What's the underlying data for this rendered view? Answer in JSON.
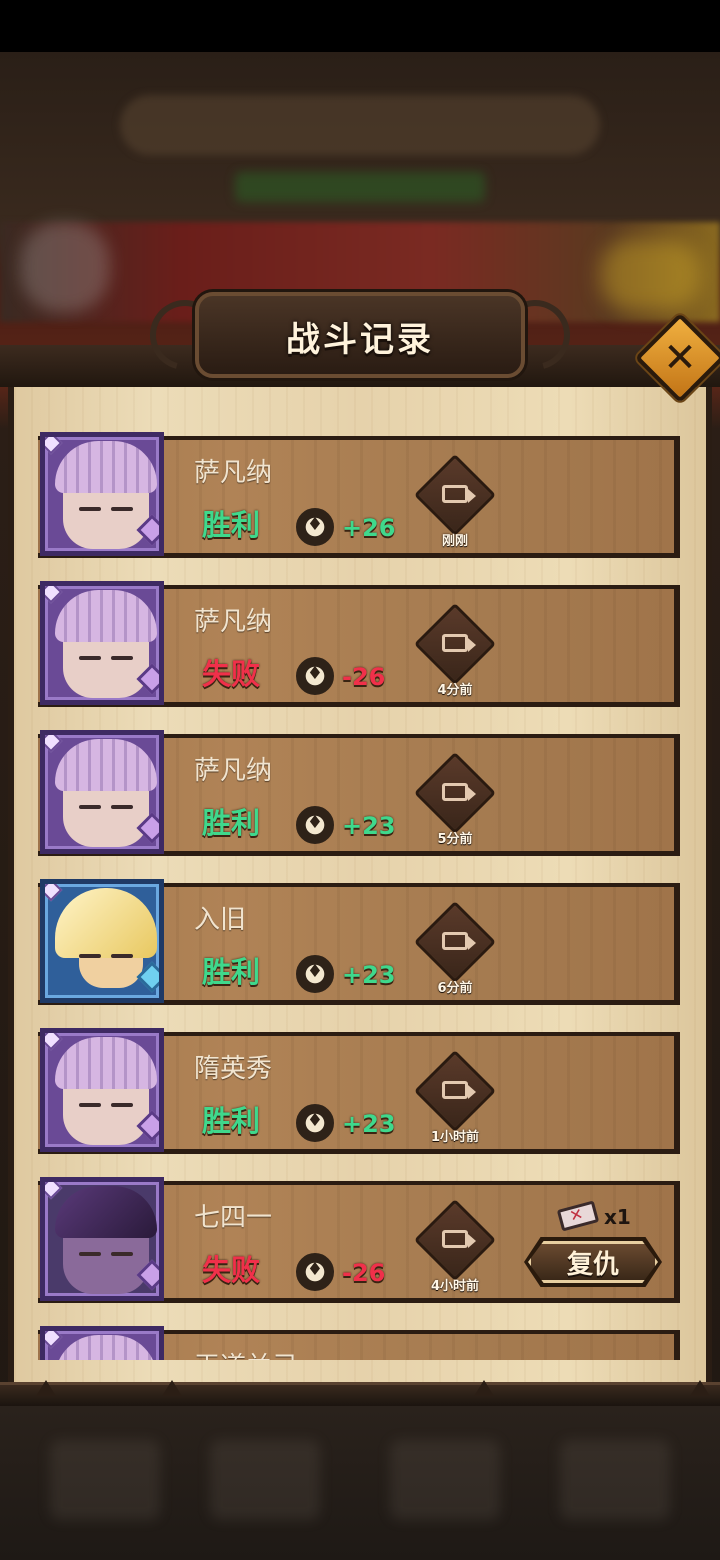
{
  "header": {
    "title": "战斗记录"
  },
  "records": [
    {
      "name": "萨凡纳",
      "result": "胜利",
      "outcome": "win",
      "score": "+26",
      "time": "刚刚",
      "avatar": "purple-haired-hero"
    },
    {
      "name": "萨凡纳",
      "result": "失败",
      "outcome": "lose",
      "score": "-26",
      "time": "4分前",
      "avatar": "purple-haired-hero"
    },
    {
      "name": "萨凡纳",
      "result": "胜利",
      "outcome": "win",
      "score": "+23",
      "time": "5分前",
      "avatar": "purple-haired-hero"
    },
    {
      "name": "入旧",
      "result": "胜利",
      "outcome": "win",
      "score": "+23",
      "time": "6分前",
      "avatar": "blonde-hero-with-frog"
    },
    {
      "name": "隋英秀",
      "result": "胜利",
      "outcome": "win",
      "score": "+23",
      "time": "1小时前",
      "avatar": "purple-haired-hero"
    },
    {
      "name": "七四一",
      "result": "失败",
      "outcome": "lose",
      "score": "-26",
      "time": "4小时前",
      "avatar": "masked-hero",
      "revenge": {
        "ticket_count": "x1",
        "label": "复仇"
      }
    },
    {
      "name": "王道兰己",
      "result": "",
      "outcome": "",
      "score": "",
      "time": "",
      "avatar": "purple-haired-hero"
    }
  ],
  "icons": {
    "close": "close-icon",
    "replay": "video-camera-icon",
    "trophy": "trophy-icon",
    "ticket": "revenge-ticket-icon"
  },
  "colors": {
    "win": "#3fd88c",
    "lose": "#f0304a",
    "panel": "#e6d2ab",
    "frame": "#2b1c12"
  }
}
